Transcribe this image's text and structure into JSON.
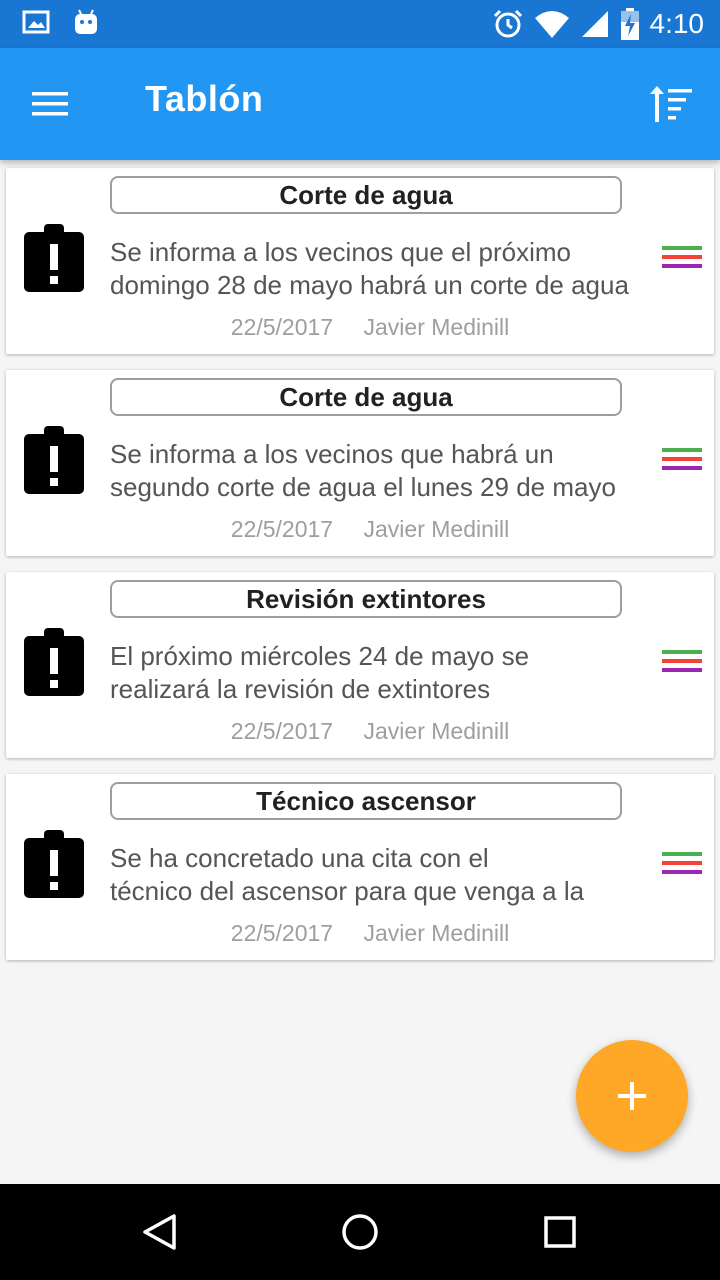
{
  "status_bar": {
    "time": "4:10",
    "icons": [
      "image-icon",
      "android-icon",
      "alarm-icon",
      "wifi-icon",
      "signal-icon",
      "battery-charging-icon"
    ],
    "background": "#1976d2"
  },
  "app_bar": {
    "title": "Tablón",
    "background": "#2196f3",
    "menu_icon": "menu-icon",
    "sort_icon": "sort-icon"
  },
  "announcements": [
    {
      "title": "Corte de agua",
      "line1": "Se informa a los vecinos que el próximo",
      "line2": "domingo 28 de mayo habrá un corte de agua",
      "date": "22/5/2017",
      "author": "Javier Medinill",
      "icon": "alert-clipboard-icon",
      "line_colors": [
        "#4caf50",
        "#f44336",
        "#9c27b0"
      ]
    },
    {
      "title": "Corte de agua",
      "line1": "Se informa a los vecinos que habrá un",
      "line2": "segundo corte de agua el lunes 29 de mayo",
      "date": "22/5/2017",
      "author": "Javier Medinill",
      "icon": "alert-clipboard-icon",
      "line_colors": [
        "#4caf50",
        "#f44336",
        "#9c27b0"
      ]
    },
    {
      "title": "Revisión extintores",
      "line1": "El próximo miércoles 24 de mayo se",
      "line2": "realizará la revisión de extintores",
      "date": "22/5/2017",
      "author": "Javier Medinill",
      "icon": "alert-clipboard-icon",
      "line_colors": [
        "#4caf50",
        "#f44336",
        "#9c27b0"
      ]
    },
    {
      "title": "Técnico ascensor",
      "line1": "Se ha concretado una cita con el",
      "line2": "técnico del ascensor para que venga a la",
      "date": "22/5/2017",
      "author": "Javier Medinill",
      "icon": "alert-clipboard-icon",
      "line_colors": [
        "#4caf50",
        "#f44336",
        "#9c27b0"
      ]
    }
  ],
  "fab": {
    "icon": "add-icon",
    "color": "#ffa726"
  },
  "nav_bar": {
    "icons": [
      "back-icon",
      "home-icon",
      "recents-icon"
    ]
  }
}
